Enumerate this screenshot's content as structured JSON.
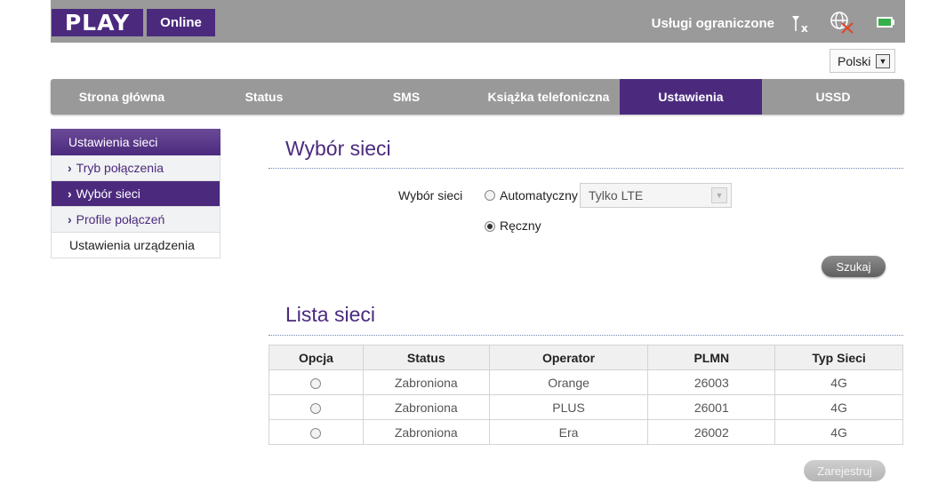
{
  "header": {
    "logo": "PLAY",
    "online_label": "Online",
    "service_status": "Usługi ograniczone",
    "icons": [
      "signal-no-service-icon",
      "globe-disconnected-icon",
      "battery-icon"
    ]
  },
  "language": {
    "selected": "Polski"
  },
  "nav": {
    "tabs": [
      {
        "label": "Strona główna",
        "active": false
      },
      {
        "label": "Status",
        "active": false
      },
      {
        "label": "SMS",
        "active": false
      },
      {
        "label": "Książka telefoniczna",
        "active": false
      },
      {
        "label": "Ustawienia",
        "active": true
      },
      {
        "label": "USSD",
        "active": false
      }
    ]
  },
  "sidebar": {
    "header": "Ustawienia sieci",
    "items": [
      {
        "label": "Tryb połączenia",
        "active": false
      },
      {
        "label": "Wybór sieci",
        "active": true
      },
      {
        "label": "Profile połączeń",
        "active": false
      },
      {
        "label": "Ustawienia urządzenia",
        "active": false
      }
    ]
  },
  "network_selection": {
    "title": "Wybór sieci",
    "field_label": "Wybór sieci",
    "auto_label": "Automatyczny",
    "auto_selected": false,
    "mode_value": "Tylko LTE",
    "manual_label": "Ręczny",
    "manual_selected": true,
    "search_button": "Szukaj"
  },
  "network_list": {
    "title": "Lista sieci",
    "columns": [
      "Opcja",
      "Status",
      "Operator",
      "PLMN",
      "Typ Sieci"
    ],
    "rows": [
      {
        "status": "Zabroniona",
        "operator": "Orange",
        "plmn": "26003",
        "type": "4G"
      },
      {
        "status": "Zabroniona",
        "operator": "PLUS",
        "plmn": "26001",
        "type": "4G"
      },
      {
        "status": "Zabroniona",
        "operator": "Era",
        "plmn": "26002",
        "type": "4G"
      }
    ],
    "register_button": "Zarejestruj"
  },
  "colors": {
    "brand": "#4b2a7e",
    "header_gray": "#9a9a9a",
    "disabled_button": "#c4c4c4"
  }
}
